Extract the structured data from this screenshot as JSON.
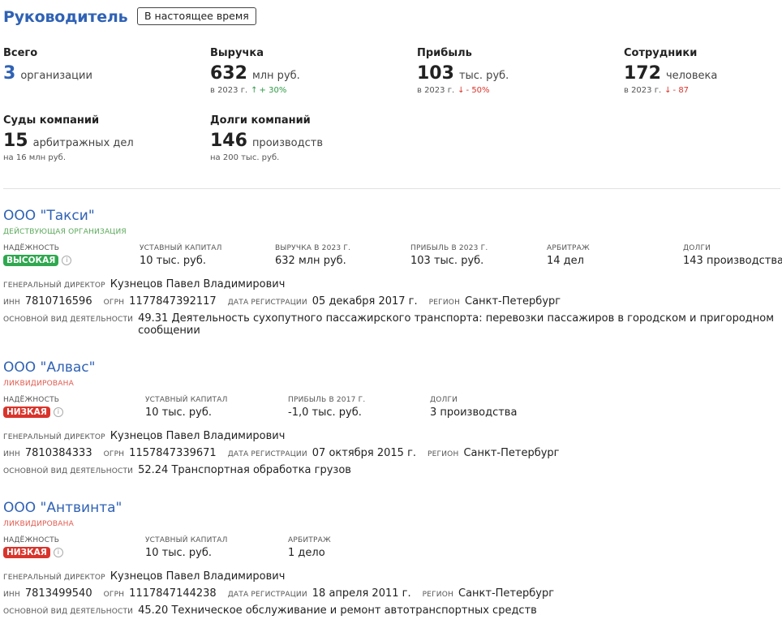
{
  "header": {
    "title": "Руководитель",
    "period_button": "В настоящее время"
  },
  "stats": {
    "total": {
      "label": "Всего",
      "value": "3",
      "unit": "организации"
    },
    "revenue": {
      "label": "Выручка",
      "value": "632",
      "unit": "млн руб.",
      "year": "в 2023 г.",
      "trend": "+ 30%",
      "trend_dir": "up"
    },
    "profit": {
      "label": "Прибыль",
      "value": "103",
      "unit": "тыс. руб.",
      "year": "в 2023 г.",
      "trend": "- 50%",
      "trend_dir": "down"
    },
    "employees": {
      "label": "Сотрудники",
      "value": "172",
      "unit": "человека",
      "year": "в 2023 г.",
      "trend": "- 87",
      "trend_dir": "down"
    },
    "courts": {
      "label": "Суды компаний",
      "value": "15",
      "unit": "арбитражных дел",
      "sub": "на 16 млн руб."
    },
    "debts": {
      "label": "Долги компаний",
      "value": "146",
      "unit": "производств",
      "sub": "на 200 тыс. руб."
    }
  },
  "labels": {
    "reliability": "НАДЁЖНОСТЬ",
    "director": "ГЕНЕРАЛЬНЫЙ ДИРЕКТОР",
    "inn": "ИНН",
    "ogrn": "ОГРН",
    "reg_date": "ДАТА РЕГИСТРАЦИИ",
    "region": "РЕГИОН",
    "activity": "ОСНОВНОЙ ВИД ДЕЯТЕЛЬНОСТИ"
  },
  "orgs": [
    {
      "name": "ООО \"Такси\"",
      "status": "ДЕЙСТВУЮЩАЯ ОРГАНИЗАЦИЯ",
      "reliability": "ВЫСОКАЯ",
      "metrics": [
        {
          "label": "УСТАВНЫЙ КАПИТАЛ",
          "value": "10 тыс. руб."
        },
        {
          "label": "ВЫРУЧКА В 2023 Г.",
          "value": "632 млн руб."
        },
        {
          "label": "ПРИБЫЛЬ В 2023 Г.",
          "value": "103 тыс. руб."
        },
        {
          "label": "АРБИТРАЖ",
          "value": "14 дел"
        },
        {
          "label": "ДОЛГИ",
          "value": "143 производства"
        }
      ],
      "director": "Кузнецов Павел Владимирович",
      "inn": "7810716596",
      "ogrn": "1177847392117",
      "reg_date": "05 декабря 2017 г.",
      "region": "Санкт-Петербург",
      "activity": "49.31 Деятельность сухопутного пассажирского транспорта: перевозки пассажиров в городском и пригородном сообщении"
    },
    {
      "name": "ООО \"Алвас\"",
      "status": "ЛИКВИДИРОВАНА",
      "reliability": "НИЗКАЯ",
      "metrics": [
        {
          "label": "УСТАВНЫЙ КАПИТАЛ",
          "value": "10 тыс. руб."
        },
        {
          "label": "ПРИБЫЛЬ В 2017 Г.",
          "value": "-1,0 тыс. руб."
        },
        {
          "label": "ДОЛГИ",
          "value": "3 производства"
        }
      ],
      "director": "Кузнецов Павел Владимирович",
      "inn": "7810384333",
      "ogrn": "1157847339671",
      "reg_date": "07 октября 2015 г.",
      "region": "Санкт-Петербург",
      "activity": "52.24 Транспортная обработка грузов"
    },
    {
      "name": "ООО \"Антвинта\"",
      "status": "ЛИКВИДИРОВАНА",
      "reliability": "НИЗКАЯ",
      "metrics": [
        {
          "label": "УСТАВНЫЙ КАПИТАЛ",
          "value": "10 тыс. руб."
        },
        {
          "label": "АРБИТРАЖ",
          "value": "1 дело"
        }
      ],
      "director": "Кузнецов Павел Владимирович",
      "inn": "7813499540",
      "ogrn": "1117847144238",
      "reg_date": "18 апреля 2011 г.",
      "region": "Санкт-Петербург",
      "activity": "45.20 Техническое обслуживание и ремонт автотранспортных средств"
    }
  ],
  "colors": {
    "accent": "#2f62b5",
    "good": "#2fa84f",
    "bad": "#d9342b"
  },
  "icons": {
    "info": "info-circle-icon",
    "up": "arrow-up-icon",
    "down": "arrow-down-icon"
  }
}
